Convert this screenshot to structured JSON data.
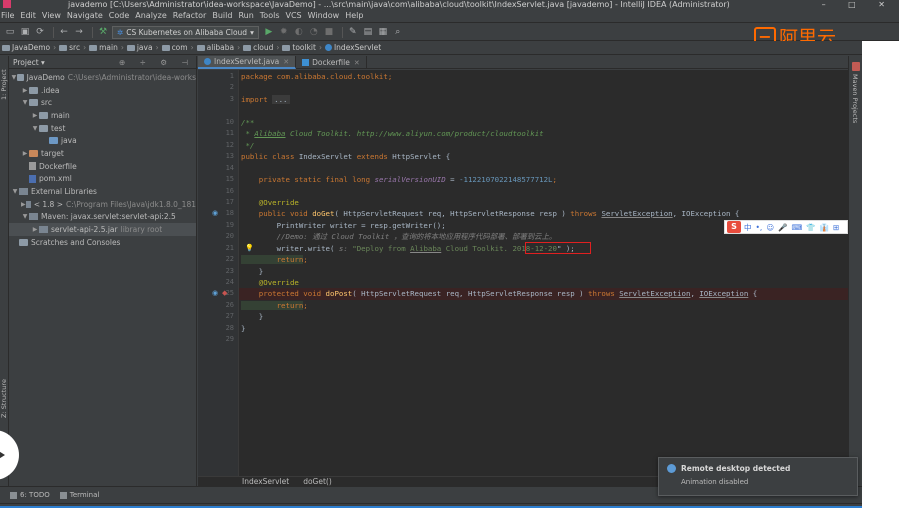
{
  "window": {
    "title": "javademo [C:\\Users\\Administrator\\idea-workspace\\JavaDemo] - ...\\src\\main\\java\\com\\alibaba\\cloud\\toolkit\\IndexServlet.java [javademo] - IntelliJ IDEA (Administrator)",
    "controls": "–  □  ✕"
  },
  "menu": [
    "File",
    "Edit",
    "View",
    "Navigate",
    "Code",
    "Analyze",
    "Refactor",
    "Build",
    "Run",
    "Tools",
    "VCS",
    "Window",
    "Help"
  ],
  "toolbar": {
    "run_config": "CS Kubernetes on Alibaba Cloud",
    "run_config_dropdown": "▾"
  },
  "logo": {
    "bracket": "[-]",
    "text": "阿里云",
    "color": "#ff6a00"
  },
  "breadcrumbs": [
    "JavaDemo",
    "src",
    "main",
    "java",
    "com",
    "alibaba",
    "cloud",
    "toolkit",
    "IndexServlet"
  ],
  "left_strip": {
    "project": "1: Project",
    "structure": "Z: Structure"
  },
  "project_panel": {
    "title": "Project ▾",
    "tree": [
      {
        "label": "JavaDemo",
        "dim": "C:\\Users\\Administrator\\idea-works",
        "indent": 0,
        "arrow": "▼",
        "icon": "folder"
      },
      {
        "label": ".idea",
        "dim": "",
        "indent": 1,
        "arrow": "▶",
        "icon": "folder"
      },
      {
        "label": "src",
        "dim": "",
        "indent": 1,
        "arrow": "▼",
        "icon": "folder"
      },
      {
        "label": "main",
        "dim": "",
        "indent": 2,
        "arrow": "▶",
        "icon": "folder"
      },
      {
        "label": "test",
        "dim": "",
        "indent": 2,
        "arrow": "▼",
        "icon": "folder"
      },
      {
        "label": "java",
        "dim": "",
        "indent": 3,
        "arrow": "",
        "icon": "folder-blue"
      },
      {
        "label": "target",
        "dim": "",
        "indent": 1,
        "arrow": "▶",
        "icon": "folder-orange"
      },
      {
        "label": "Dockerfile",
        "dim": "",
        "indent": 1,
        "arrow": "",
        "icon": "file"
      },
      {
        "label": "pom.xml",
        "dim": "",
        "indent": 1,
        "arrow": "",
        "icon": "file-m"
      },
      {
        "label": "External Libraries",
        "dim": "",
        "indent": 0,
        "arrow": "▼",
        "icon": "lib"
      },
      {
        "label": "< 1.8 >",
        "dim": "C:\\Program Files\\Java\\jdk1.8.0_181",
        "indent": 1,
        "arrow": "▶",
        "icon": "lib"
      },
      {
        "label": "Maven: javax.servlet:servlet-api:2.5",
        "dim": "",
        "indent": 1,
        "arrow": "▼",
        "icon": "lib"
      },
      {
        "label": "servlet-api-2.5.jar",
        "dim": "library root",
        "indent": 2,
        "arrow": "▶",
        "icon": "lib",
        "selected": true
      },
      {
        "label": "Scratches and Consoles",
        "dim": "",
        "indent": 0,
        "arrow": "",
        "icon": "folder"
      }
    ]
  },
  "tabs": [
    {
      "label": "IndexServlet.java",
      "active": true,
      "icon": "java"
    },
    {
      "label": "Dockerfile",
      "active": false,
      "icon": "docker"
    }
  ],
  "editor": {
    "line_numbers": [
      "1",
      "2",
      "3",
      "10",
      "11",
      "12",
      "13",
      "14",
      "15",
      "16",
      "17",
      "18",
      "19",
      "20",
      "21",
      "22",
      "23",
      "24",
      "25",
      "26",
      "27",
      "28",
      "29"
    ],
    "code": {
      "l1": "package com.alibaba.cloud.toolkit;",
      "l3_kw": "import",
      "l3_fold": "...",
      "l10": "/**",
      "l11_a": " * ",
      "l11_u": "Alibaba",
      "l11_b": " Cloud Toolkit. http://www.aliyun.com/product/cloudtoolkit",
      "l12": " */",
      "l13_kw": "public class",
      "l13_name": " IndexServlet ",
      "l13_ext": "extends",
      "l13_sup": " HttpServlet {",
      "l15_kw": "    private static final long ",
      "l15_fld": "serialVersionUID",
      "l15_eq": " = ",
      "l15_num": "-1122107022148577712L",
      "l15_end": ";",
      "l17": "    @Override",
      "l18_kw": "    public void ",
      "l18_fn": "doGet",
      "l18_a": "( HttpServletRequest req, HttpServletResponse resp ) ",
      "l18_th": "throws",
      "l18_ex1": "ServletException",
      "l18_b": ", IOException {",
      "l19": "        PrintWriter writer = resp.getWriter();",
      "l20": "        //Demo: 通过 Cloud Toolkit ，查询的将本地应用程序代码部署、部署到云上。",
      "l21_a": "        writer.write( ",
      "l21_x": "s:",
      "l21_s1": " \"Deploy from ",
      "l21_u": "Alibaba",
      "l21_s2": " Cloud Toolkit. ",
      "l21_s3": "2018-12-20",
      "l21_end": "\" );",
      "l22_kw": "        return",
      "l22_end": ";",
      "l23": "    }",
      "l24": "    @Override",
      "l25_kw": "    protected void ",
      "l25_fn": "doPost",
      "l25_a": "( HttpServletRequest req, HttpServletResponse resp ) ",
      "l25_th": "throws",
      "l25_ex1": "ServletException",
      "l25_c": ", ",
      "l25_ex2": "IOException",
      "l25_b": " {",
      "l26_kw": "        return",
      "l26_end": ";",
      "l27": "    }",
      "l28": "}"
    }
  },
  "ime": {
    "logo": "S",
    "items": [
      "中",
      "•,",
      "☺",
      "🎤",
      "⌨",
      "👕",
      "👔",
      "⊞"
    ]
  },
  "editor_breadcrumb": [
    "IndexServlet",
    "doGet()"
  ],
  "right_strip": {
    "label": "Maven Projects"
  },
  "bottom_tools": [
    {
      "label": "6: TODO"
    },
    {
      "label": "Terminal"
    }
  ],
  "notification": {
    "title": "Remote desktop detected",
    "body": "Animation disabled"
  }
}
